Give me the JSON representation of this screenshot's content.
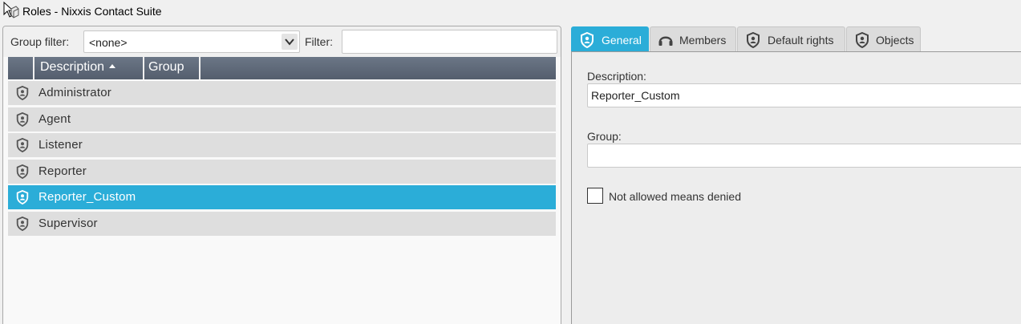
{
  "window": {
    "title": "Roles - Nixxis Contact Suite",
    "icon": "window-icon"
  },
  "filters": {
    "group_filter_label": "Group filter:",
    "group_filter_value": "<none>",
    "filter_label": "Filter:",
    "filter_value": ""
  },
  "grid": {
    "columns": [
      {
        "label": "Description",
        "sorted": "ascending"
      },
      {
        "label": "Group"
      }
    ],
    "rows": [
      {
        "label": "Administrator",
        "icon": "role-shield-icon",
        "selected": false
      },
      {
        "label": "Agent",
        "icon": "role-shield-icon",
        "selected": false
      },
      {
        "label": "Listener",
        "icon": "role-shield-icon",
        "selected": false
      },
      {
        "label": "Reporter",
        "icon": "role-shield-icon",
        "selected": false
      },
      {
        "label": "Reporter_Custom",
        "icon": "role-shield-icon",
        "selected": true
      },
      {
        "label": "Supervisor",
        "icon": "role-shield-icon",
        "selected": false
      }
    ]
  },
  "tabs": [
    {
      "label": "General",
      "icon": "shield-icon",
      "active": true
    },
    {
      "label": "Members",
      "icon": "headset-icon",
      "active": false
    },
    {
      "label": "Default rights",
      "icon": "shield-icon",
      "active": false
    },
    {
      "label": "Objects",
      "icon": "shield-icon",
      "active": false
    }
  ],
  "details": {
    "description_label": "Description:",
    "description_value": "Reporter_Custom",
    "group_label": "Group:",
    "group_value": "",
    "checkbox_label": "Not allowed means denied",
    "checkbox_checked": false
  },
  "colors": {
    "accent": "#2badd8",
    "header": "#5f6979",
    "row": "#dedede"
  }
}
